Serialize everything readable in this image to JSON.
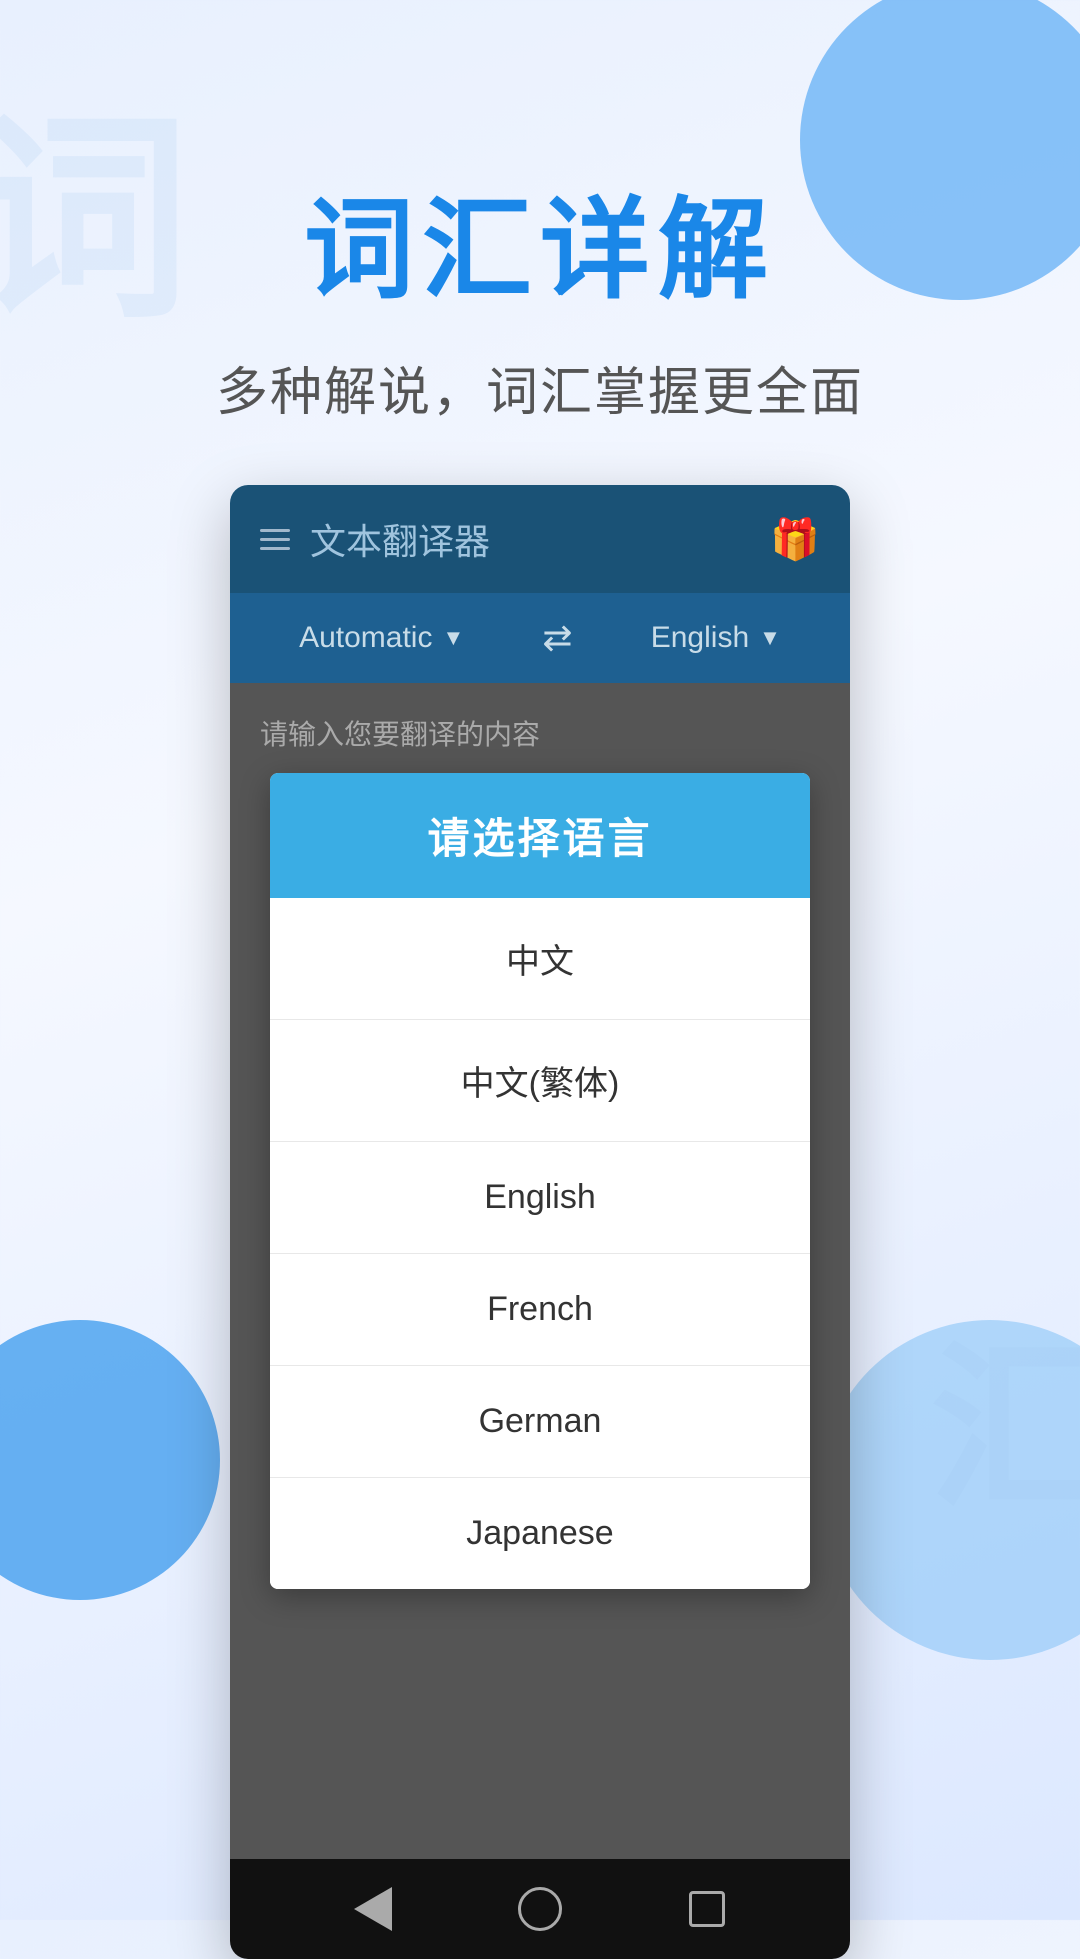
{
  "background": {
    "watermark_top": "词",
    "watermark_bottom": "汇"
  },
  "header": {
    "title": "词汇详解",
    "subtitle": "多种解说，词汇掌握更全面"
  },
  "appbar": {
    "title": "文本翻译器",
    "gift_icon": "🎁"
  },
  "lang_bar": {
    "source_lang": "Automatic",
    "target_lang": "English",
    "swap_icon": "⇄"
  },
  "content": {
    "input_hint": "请输入您要翻译的内容"
  },
  "dialog": {
    "title": "请选择语言",
    "items": [
      {
        "label": "中文"
      },
      {
        "label": "中文(繁体)"
      },
      {
        "label": "English"
      },
      {
        "label": "French"
      },
      {
        "label": "German"
      },
      {
        "label": "Japanese"
      }
    ]
  },
  "navbar": {
    "back_label": "back",
    "home_label": "home",
    "recents_label": "recents"
  }
}
